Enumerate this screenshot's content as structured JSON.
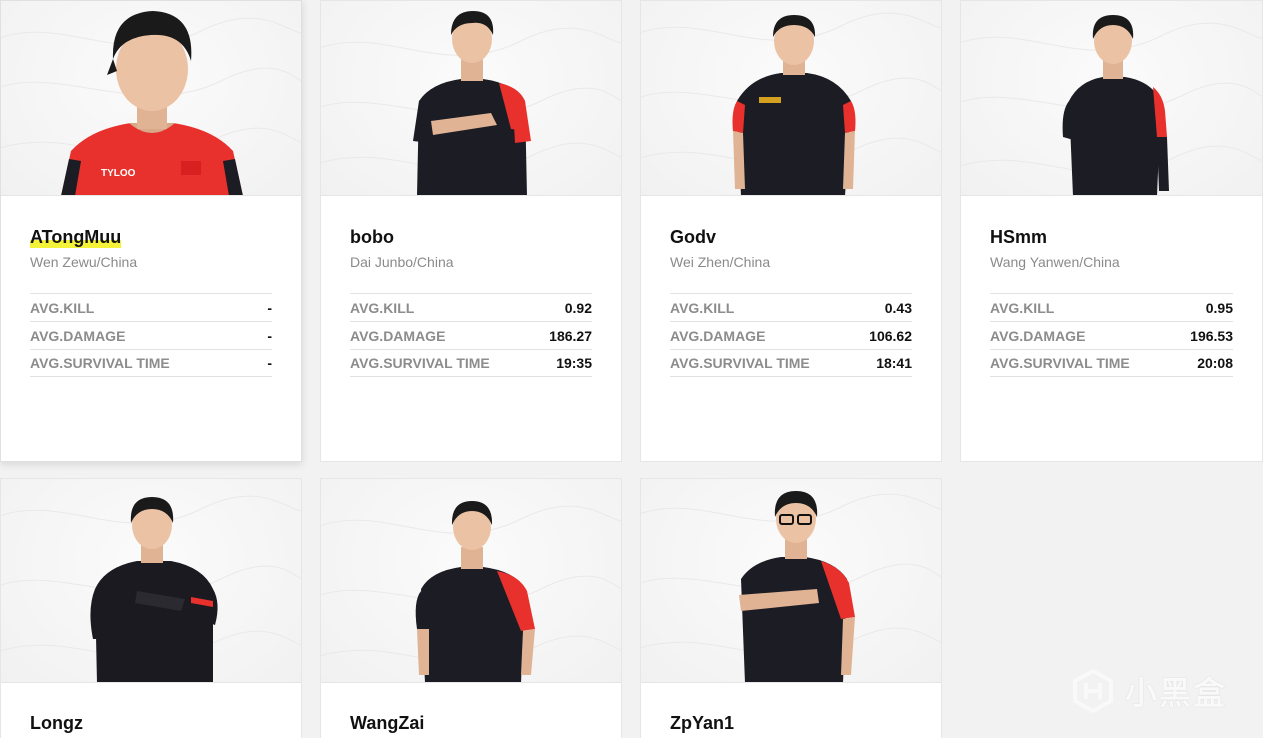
{
  "players": [
    {
      "name": "ATongMuu",
      "realname": "Wen Zewu/China",
      "highlighted": true,
      "jersey": "red",
      "stats": [
        {
          "label": "AVG.KILL",
          "value": "-"
        },
        {
          "label": "AVG.DAMAGE",
          "value": "-"
        },
        {
          "label": "AVG.SURVIVAL TIME",
          "value": "-"
        }
      ]
    },
    {
      "name": "bobo",
      "realname": "Dai Junbo/China",
      "highlighted": false,
      "jersey": "black",
      "stats": [
        {
          "label": "AVG.KILL",
          "value": "0.92"
        },
        {
          "label": "AVG.DAMAGE",
          "value": "186.27"
        },
        {
          "label": "AVG.SURVIVAL TIME",
          "value": "19:35"
        }
      ]
    },
    {
      "name": "Godv",
      "realname": "Wei Zhen/China",
      "highlighted": false,
      "jersey": "black",
      "stats": [
        {
          "label": "AVG.KILL",
          "value": "0.43"
        },
        {
          "label": "AVG.DAMAGE",
          "value": "106.62"
        },
        {
          "label": "AVG.SURVIVAL TIME",
          "value": "18:41"
        }
      ]
    },
    {
      "name": "HSmm",
      "realname": "Wang Yanwen/China",
      "highlighted": false,
      "jersey": "black",
      "stats": [
        {
          "label": "AVG.KILL",
          "value": "0.95"
        },
        {
          "label": "AVG.DAMAGE",
          "value": "196.53"
        },
        {
          "label": "AVG.SURVIVAL TIME",
          "value": "20:08"
        }
      ]
    },
    {
      "name": "Longz",
      "realname": "",
      "highlighted": false,
      "jersey": "hoodie",
      "stats": []
    },
    {
      "name": "WangZai",
      "realname": "",
      "highlighted": false,
      "jersey": "black",
      "stats": []
    },
    {
      "name": "ZpYan1",
      "realname": "",
      "highlighted": false,
      "jersey": "black",
      "stats": []
    }
  ],
  "watermark": {
    "text": "小黑盒",
    "icon": "heybox-logo-icon"
  },
  "colors": {
    "accent_red": "#e8312c",
    "jersey_black": "#1c1c24",
    "highlight": "#f5f23a"
  }
}
